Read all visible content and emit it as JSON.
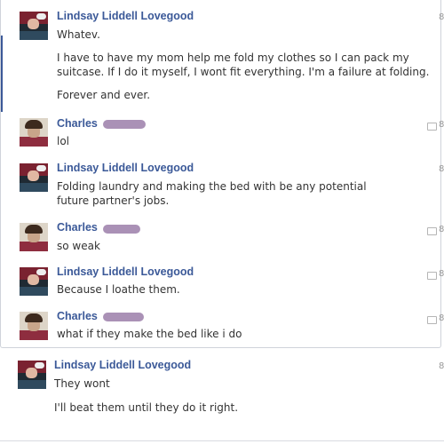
{
  "messages": [
    {
      "author": "Lindsay Liddell Lovegood",
      "paragraphs": [
        "Whatev.",
        "I have to have my mom help me fold my clothes so I can pack my suitcase. If I do it myself, I wont fit everything. I'm a failure at folding.",
        "Forever and ever."
      ],
      "time": "8"
    },
    {
      "author": "Charles",
      "paragraphs": [
        "lol"
      ],
      "time": "8"
    },
    {
      "author": "Lindsay Liddell Lovegood",
      "paragraphs": [
        "Folding laundry and making the bed with be any potential future partner's jobs."
      ],
      "time": "8"
    },
    {
      "author": "Charles",
      "paragraphs": [
        "so weak"
      ],
      "time": "8"
    },
    {
      "author": "Lindsay Liddell Lovegood",
      "paragraphs": [
        "Because I loathe them."
      ],
      "time": "8"
    },
    {
      "author": "Charles",
      "paragraphs": [
        "what if they make the bed like i do"
      ],
      "time": "8"
    },
    {
      "author": "Lindsay Liddell Lovegood",
      "paragraphs": [
        "They wont",
        "I'll beat them until they do it right."
      ],
      "time": "8"
    }
  ],
  "colors": {
    "author": "#3b5998",
    "redaction": "#9b7ea9",
    "border": "#cfd3da"
  },
  "icons": {
    "reply": "reply-icon",
    "avatar_lindsay": "avatar-lindsay",
    "avatar_charles": "avatar-charles"
  }
}
